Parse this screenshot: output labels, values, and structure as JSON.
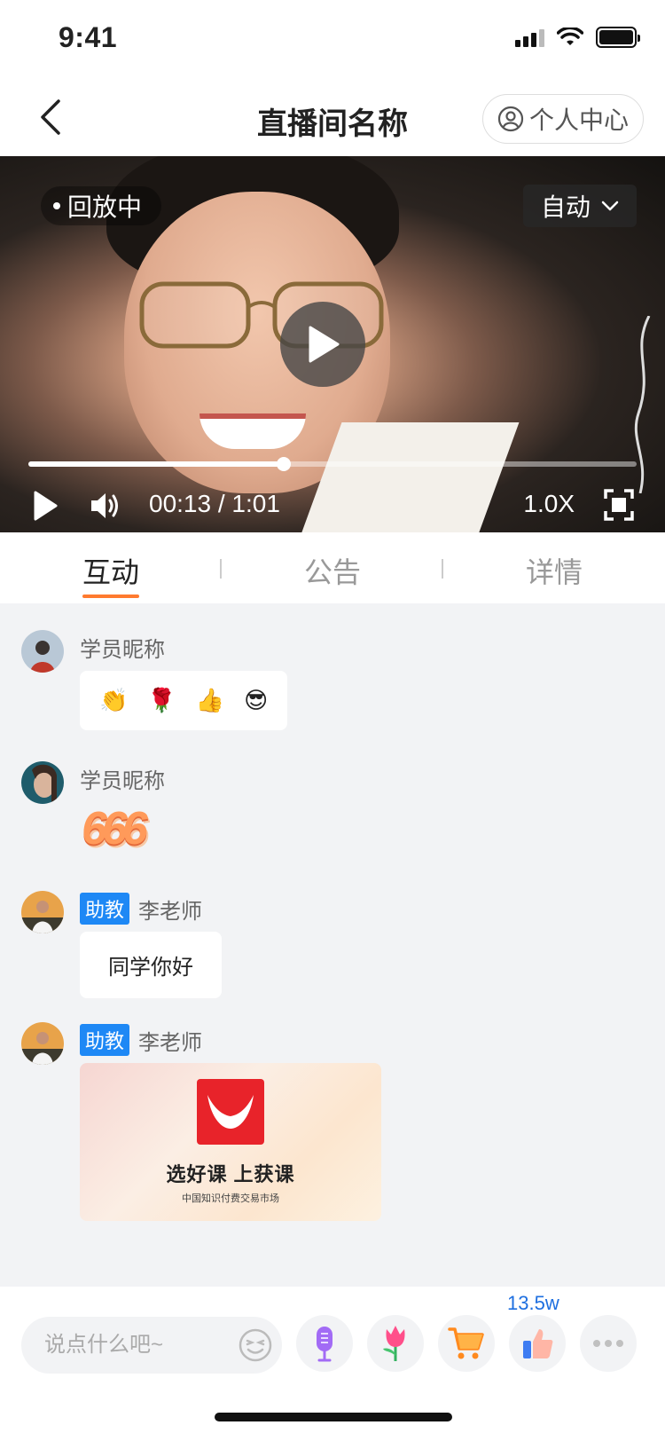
{
  "status_bar": {
    "time": "9:41"
  },
  "nav": {
    "title": "直播间名称",
    "profile_label": "个人中心"
  },
  "video": {
    "status_badge": "回放中",
    "quality_label": "自动",
    "progress": 0.42,
    "time_current": "00:13",
    "time_separator": "/",
    "time_total": "1:01",
    "speed": "1.0X"
  },
  "tabs": [
    {
      "label": "互动",
      "active": true
    },
    {
      "label": "公告",
      "active": false
    },
    {
      "label": "详情",
      "active": false
    }
  ],
  "messages": [
    {
      "name": "学员昵称",
      "type": "emoji",
      "emojis": [
        "👏",
        "🌹",
        "👍",
        "😎"
      ]
    },
    {
      "name": "学员昵称",
      "type": "sticker",
      "sticker": "666"
    },
    {
      "role": "助教",
      "name": "李老师",
      "type": "text",
      "text": "同学你好"
    },
    {
      "role": "助教",
      "name": "李老师",
      "type": "card",
      "card_title": "选好课 上获课",
      "card_subtitle": "中国知识付费交易市场"
    }
  ],
  "bottom": {
    "input_placeholder": "说点什么吧~",
    "like_count": "13.5w"
  },
  "colors": {
    "accent": "#ff7a2f",
    "role_tag": "#1e88f5",
    "like_count": "#1e6fe0"
  }
}
